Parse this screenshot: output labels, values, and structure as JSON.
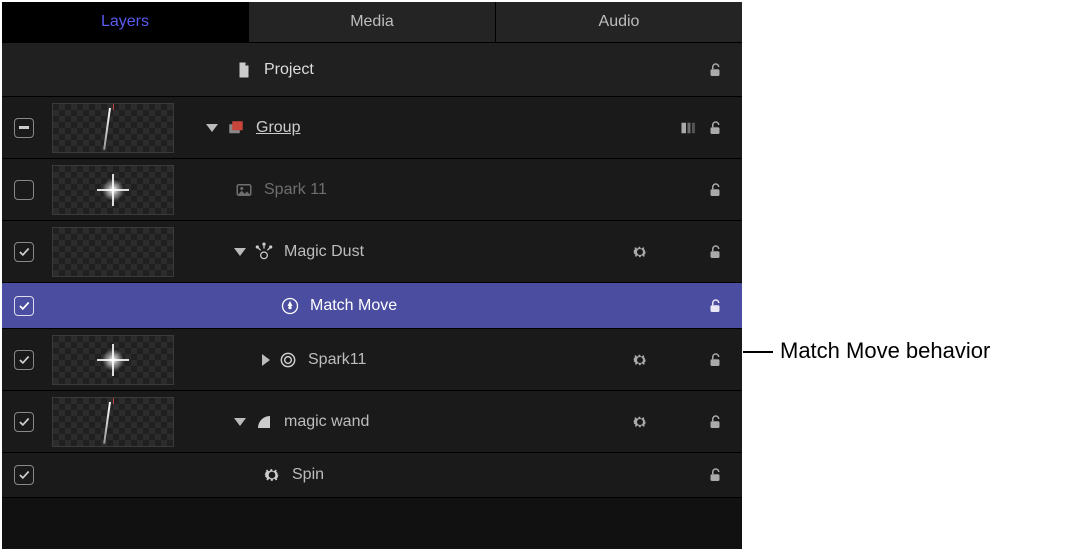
{
  "tabs": {
    "layers": "Layers",
    "media": "Media",
    "audio": "Audio"
  },
  "rows": {
    "project": "Project",
    "group": "Group",
    "spark11_dim": "Spark 11",
    "magic_dust": "Magic Dust",
    "match_move": "Match Move",
    "spark11": "Spark11",
    "magic_wand": "magic wand",
    "spin": "Spin"
  },
  "callout": "Match Move behavior"
}
